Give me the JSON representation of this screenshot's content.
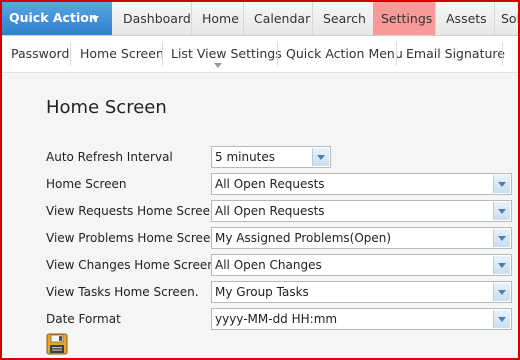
{
  "topnav": {
    "quick_action": "Quick Action",
    "items": [
      "Dashboard",
      "Home",
      "Calendar",
      "Search",
      "Settings",
      "Assets",
      "Sol"
    ]
  },
  "subnav": {
    "items": [
      "Password",
      "Home Screen",
      "List View Settings",
      "Quick Action Menu",
      "Email Signature"
    ]
  },
  "panel": {
    "title": "Home Screen",
    "rows": [
      {
        "label": "Auto Refresh Interval",
        "value": "5 minutes"
      },
      {
        "label": "Home Screen",
        "value": "All Open Requests"
      },
      {
        "label": "View Requests Home Screen.",
        "value": "All Open Requests"
      },
      {
        "label": "View Problems Home Screen",
        "value": "My Assigned Problems(Open)"
      },
      {
        "label": "View Changes Home Screen",
        "value": "All Open Changes"
      },
      {
        "label": "View Tasks Home Screen.",
        "value": "My Group Tasks"
      },
      {
        "label": "Date Format",
        "value": "yyyy-MM-dd HH:mm"
      }
    ]
  },
  "icons": {
    "quick_action_caret": "chevron-down-icon",
    "save": "floppy-disk-icon"
  },
  "colors": {
    "quick_action_bg": "#3a8ad5",
    "settings_tab_bg": "#f79a9a",
    "frame_border": "#d40000"
  }
}
